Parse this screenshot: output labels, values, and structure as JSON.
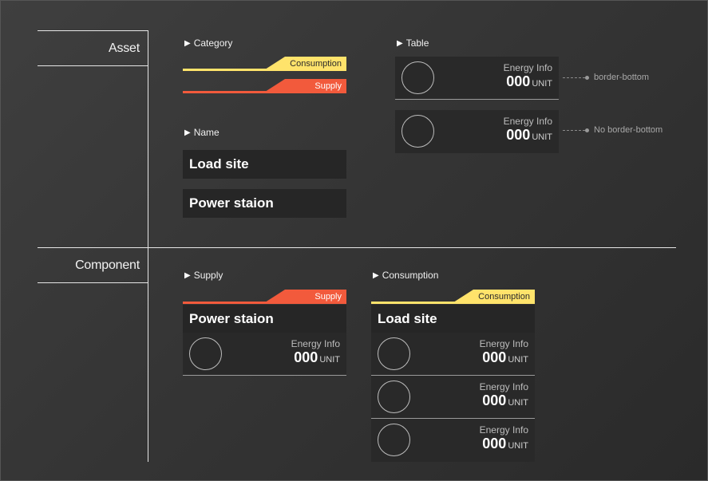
{
  "sections": {
    "asset": "Asset",
    "component": "Component"
  },
  "asset": {
    "category_heading": "Category",
    "categories": {
      "consumption": "Consumption",
      "supply": "Supply"
    },
    "name_heading": "Name",
    "names": [
      "Load site",
      "Power staion"
    ],
    "table_heading": "Table",
    "table_rows": [
      {
        "label": "Energy Info",
        "value": "000",
        "unit": "UNIT",
        "note": "border-bottom"
      },
      {
        "label": "Energy Info",
        "value": "000",
        "unit": "UNIT",
        "note": "No border-bottom"
      }
    ]
  },
  "component": {
    "supply": {
      "heading": "Supply",
      "tag": "Supply",
      "name": "Power staion",
      "rows": [
        {
          "label": "Energy Info",
          "value": "000",
          "unit": "UNIT"
        }
      ]
    },
    "consumption": {
      "heading": "Consumption",
      "tag": "Consumption",
      "name": "Load site",
      "rows": [
        {
          "label": "Energy Info",
          "value": "000",
          "unit": "UNIT"
        },
        {
          "label": "Energy Info",
          "value": "000",
          "unit": "UNIT"
        },
        {
          "label": "Energy Info",
          "value": "000",
          "unit": "UNIT"
        }
      ]
    }
  },
  "colors": {
    "consumption": "#ffe36b",
    "supply": "#f25a3c",
    "panel": "#292929"
  },
  "icons": {
    "heading_marker": "triangle-right-icon",
    "row_avatar": "circle-icon"
  }
}
